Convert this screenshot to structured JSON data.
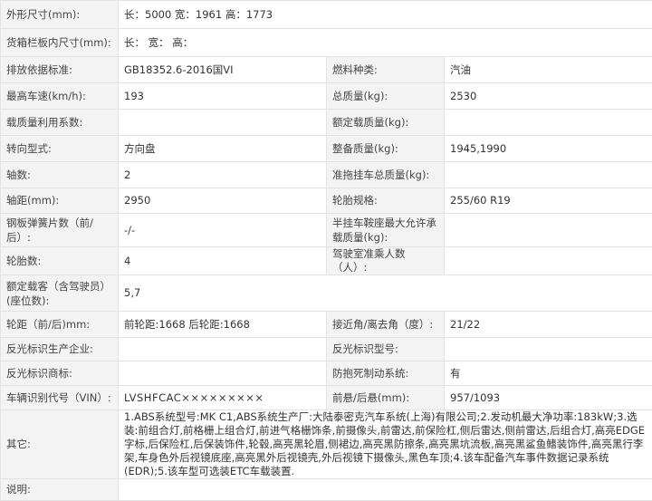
{
  "rows": {
    "dims": {
      "label": "外形尺寸(mm):",
      "value": "长：5000 宽：1961 高：1773"
    },
    "cargo": {
      "label": "货箱栏板内尺寸(mm):",
      "value": "长： 宽： 高："
    },
    "emission": {
      "label": "排放依据标准:",
      "value": "GB18352.6-2016国VI",
      "label2": "燃料种类:",
      "value2": "汽油"
    },
    "speed": {
      "label": "最高车速(km/h):",
      "value": "193",
      "label2": "总质量(kg):",
      "value2": "2530"
    },
    "load": {
      "label": "载质量利用系数:",
      "value": "",
      "label2": "额定载质量(kg):",
      "value2": ""
    },
    "steering": {
      "label": "转向型式:",
      "value": "方向盘",
      "label2": "整备质量(kg):",
      "value2": "1945,1990"
    },
    "axles": {
      "label": "轴数:",
      "value": "2",
      "label2": "准拖挂车总质量(kg):",
      "value2": ""
    },
    "wheelbase": {
      "label": "轴距(mm):",
      "value": "2950",
      "label2": "轮胎规格:",
      "value2": "255/60 R19"
    },
    "springs": {
      "label": "钢板弹簧片数（前/后）:",
      "value": "-/-",
      "label2": "半挂车鞍座最大允许承载质量(kg):",
      "value2": ""
    },
    "tires": {
      "label": "轮胎数:",
      "value": "4",
      "label2": "驾驶室准乘人数（人）:",
      "value2": ""
    },
    "seats": {
      "label": "额定载客（含驾驶员）(座位数):",
      "value": "5,7"
    },
    "track": {
      "label": "轮距（前/后)mm:",
      "value": "前轮距:1668 后轮距:1668",
      "label2": "接近角/离去角（度）:",
      "value2": "21/22"
    },
    "reflect_maker": {
      "label": "反光标识生产企业:",
      "value": "",
      "label2": "反光标识型号:",
      "value2": ""
    },
    "reflect_mark": {
      "label": "反光标识商标:",
      "value": "",
      "label2": "防抱死制动系统:",
      "value2": "有"
    },
    "vin": {
      "label": "车辆识别代号（VIN）:",
      "value": "LVSHFCAC×××××××××",
      "label2": "前悬/后悬(mm):",
      "value2": "957/1093"
    },
    "other": {
      "label": "其它:",
      "value": "1.ABS系统型号:MK C1,ABS系统生产厂:大陆泰密克汽车系统(上海)有限公司;2.发动机最大净功率:183kW;3.选装:前组合灯,前格栅上组合灯,前进气格栅饰条,前摄像头,前雷达,前保险杠,侧后雷达,侧前雷达,后组合灯,高亮EDGE字标,后保险杠,后保装饰件,轮毂,高亮黑轮眉,侧裙边,高亮黑防擦条,高亮黑坑流板,高亮黑鲨鱼鳍装饰件,高亮黑行李架,车身色外后视镜底座,高亮黑外后视镜壳,外后视镜下摄像头,黑色车顶;4.该车配备汽车事件数据记录系统(EDR);5.该车型可选装ETC车载装置."
    },
    "remark": {
      "label": "说明:",
      "value": ""
    }
  }
}
